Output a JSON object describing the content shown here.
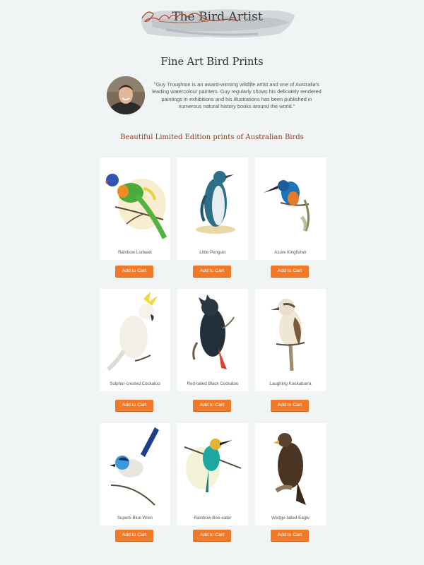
{
  "header": {
    "site_title": "The Bird Artist",
    "signature": "Guy Troughton"
  },
  "page_title": "Fine Art Bird Prints",
  "bio": "\"Guy Troughton is an award-winning wildlife artist and one of Australia's leading watercolour painters. Guy regularly shows his delicately rendered paintings in exhibitions and his illustrations has been published in numerous natural history books around the world.\"",
  "subheading": "Beautiful Limited Edition prints of Australian Birds",
  "button_label": "Add to Cart",
  "prints": [
    {
      "name": "Rainbow Lorikeet"
    },
    {
      "name": "Little Penguin"
    },
    {
      "name": "Azure Kingfisher"
    },
    {
      "name": "Sulphur-crested Cockatoo"
    },
    {
      "name": "Red-tailed Black Cockatoo"
    },
    {
      "name": "Laughing Kookaburra"
    },
    {
      "name": "Superb Blue Wren"
    },
    {
      "name": "Rainbow Bee-eater"
    },
    {
      "name": "Wedge-tailed Eagle"
    }
  ],
  "colors": {
    "background": "#f1f4f5",
    "card": "#ffffff",
    "accent_button": "#f07a2a",
    "subheading": "#8a3b1b"
  }
}
